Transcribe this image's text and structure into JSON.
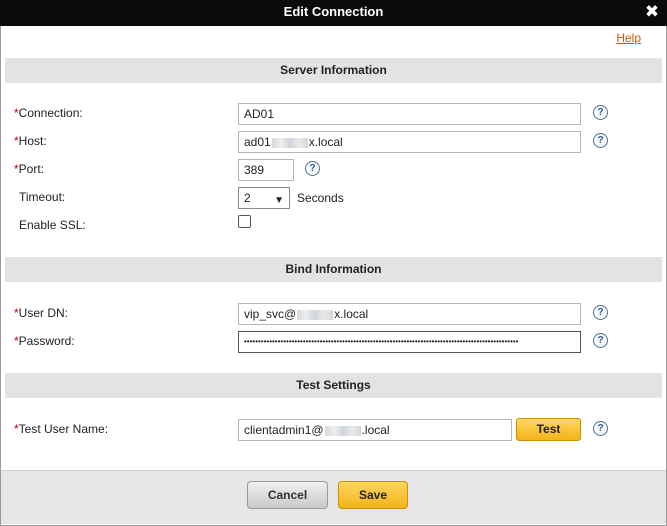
{
  "window": {
    "title": "Edit Connection"
  },
  "help_label": "Help",
  "sections": {
    "server": "Server Information",
    "bind": "Bind Information",
    "test": "Test Settings"
  },
  "required_mark": "*",
  "server": {
    "connection_label": "Connection:",
    "connection_value": "AD01",
    "host_label": "Host:",
    "host_prefix": "ad01",
    "host_suffix": "x.local",
    "port_label": "Port:",
    "port_value": "389",
    "timeout_label": "Timeout:",
    "timeout_value": "2",
    "timeout_unit": "Seconds",
    "ssl_label": "Enable SSL:",
    "ssl_checked": false
  },
  "bind": {
    "user_dn_label": "User DN:",
    "user_dn_prefix": "vip_svc@",
    "user_dn_suffix": "x.local",
    "password_label": "Password:",
    "password_mask": "••••••••••••••••••••••••••••••••••••••••••••••••••••••••••••••••••••••••••••••••••••••••••••••••••"
  },
  "test": {
    "user_label": "Test User Name:",
    "user_prefix": "clientadmin1@",
    "user_suffix": ".local",
    "test_button": "Test"
  },
  "footer": {
    "cancel": "Cancel",
    "save": "Save"
  },
  "help_icon_glyph": "?",
  "close_glyph": "✖",
  "select_chevron": "▼",
  "colors": {
    "titlebar": "#0b0b0b",
    "accent_button": "#f3b31a",
    "required": "#cc0000",
    "help_link": "#d35400",
    "section_header": "#e3e3e3"
  }
}
